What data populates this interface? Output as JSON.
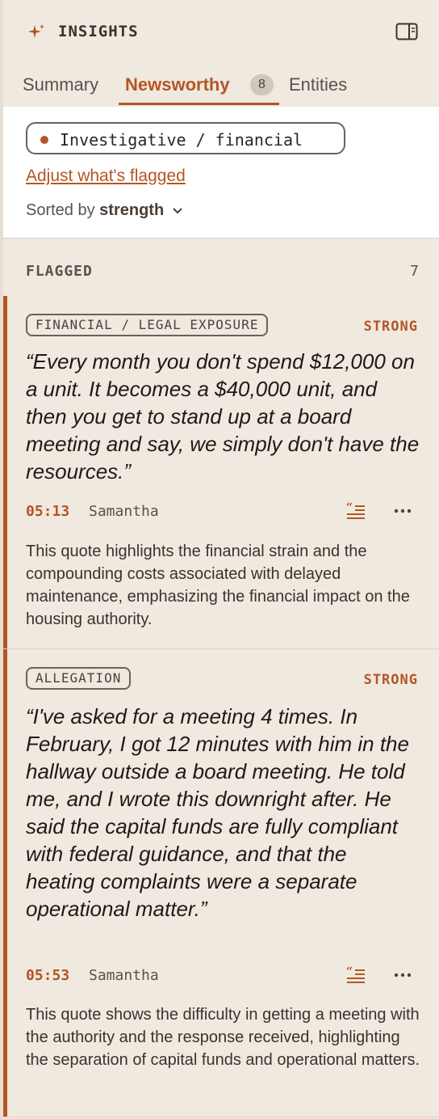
{
  "header": {
    "title": "INSIGHTS"
  },
  "tabs": [
    {
      "label": "Summary"
    },
    {
      "label": "Newsworthy",
      "badge": "8"
    },
    {
      "label": "Entities"
    }
  ],
  "filter": {
    "chip_label": "Investigative / financial",
    "adjust_link": "Adjust what's flagged",
    "sorted_prefix": "Sorted by",
    "sorted_value": "strength"
  },
  "section": {
    "title": "FLAGGED",
    "count": "7"
  },
  "cards": [
    {
      "tag": "FINANCIAL / LEGAL EXPOSURE",
      "strength": "STRONG",
      "quote": "“Every month you don't spend $12,000 on a unit. It becomes a $40,000 unit, and then you get to stand up at a board meeting and say, we simply don't have the resources.”",
      "time": "05:13",
      "speaker": "Samantha",
      "explanation": "This quote highlights the financial strain and the compounding costs associated with delayed maintenance, emphasizing the financial impact on the housing authority."
    },
    {
      "tag": "ALLEGATION",
      "strength": "STRONG",
      "quote": "“I've asked for a meeting 4 times. In February, I got 12 minutes with him in the hallway outside a board meeting. He told me, and I wrote this downright after. He said the capital funds are fully compliant with federal guidance, and that the heating complaints were a separate operational matter.”",
      "time": "05:53",
      "speaker": "Samantha",
      "explanation": "This quote shows the difficulty in getting a meeting with the authority and the response received, highlighting the separation of capital funds and operational matters."
    }
  ],
  "colors": {
    "accent": "#b35624",
    "background": "#efe9e0"
  }
}
